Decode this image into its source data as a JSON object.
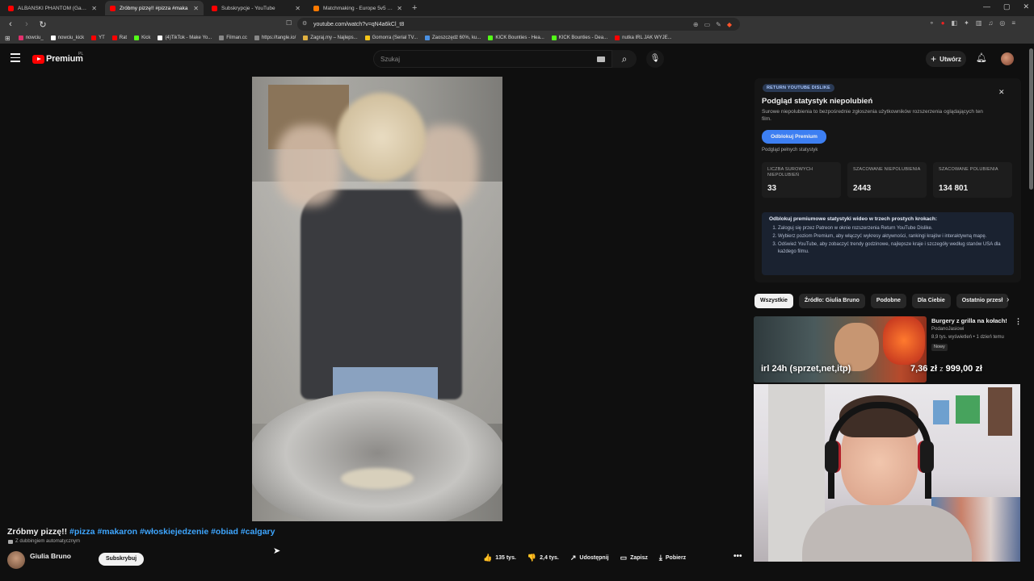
{
  "browser": {
    "tabs": [
      {
        "title": "ALBAŃSKI PHANTOM (Gang albani",
        "color": "#ff0000",
        "active": false
      },
      {
        "title": "Zróbmy pizzę!! #pizza #maka",
        "color": "#ff0000",
        "active": true
      },
      {
        "title": "Subskrypcje - YouTube",
        "color": "#ff0000",
        "active": false
      },
      {
        "title": "Matchmaking - Europe 5v5 Queue -",
        "color": "#ff7a00",
        "active": false
      }
    ],
    "url": "youtube.com/watch?v=qN4a6kCl_t8",
    "bookmarks": [
      {
        "label": "nowciu_",
        "color": "#e1306c"
      },
      {
        "label": "nowciu_kick",
        "color": "#ffffff"
      },
      {
        "label": "YT",
        "color": "#ff0000"
      },
      {
        "label": "Rat",
        "color": "#ff0000"
      },
      {
        "label": "Kick",
        "color": "#53fc18"
      },
      {
        "label": "(4)TikTok - Make Yo...",
        "color": "#ffffff"
      },
      {
        "label": "Filman.cc",
        "color": "#888888"
      },
      {
        "label": "https://tangle.io/",
        "color": "#888888"
      },
      {
        "label": "Zagraj.my – Najleps...",
        "color": "#e0b040"
      },
      {
        "label": "Gomorra (Serial TV...",
        "color": "#f5c518"
      },
      {
        "label": "Zaoszczędź 60%, ku...",
        "color": "#4a90e2"
      },
      {
        "label": "KICK Bounties - Hea...",
        "color": "#53fc18"
      },
      {
        "label": "KICK Bounties - Dea...",
        "color": "#53fc18"
      },
      {
        "label": "nutka IRL JAK WYJE...",
        "color": "#ff0000"
      }
    ]
  },
  "header": {
    "logo_text": "Premium",
    "logo_region": "PL",
    "search_placeholder": "Szukaj",
    "create_label": "Utwórz"
  },
  "video": {
    "title": "Zróbmy pizzę!!",
    "hashtags": "#pizza #makaron #włoskiejedzenie #obiad #calgary",
    "dub_note": "Z dubbingiem automatycznym",
    "channel": "Giulia Bruno",
    "subscribe_label": "Subskrybuj",
    "actions": [
      {
        "icon": "like-icon",
        "glyph": "👍",
        "label": "135 tys."
      },
      {
        "icon": "dislike-icon",
        "glyph": "👎",
        "label": "2,4 tys."
      },
      {
        "icon": "share-icon",
        "glyph": "↗",
        "label": "Udostępnij"
      },
      {
        "icon": "save-icon",
        "glyph": "▭",
        "label": "Zapisz"
      },
      {
        "icon": "download-icon",
        "glyph": "⤓",
        "label": "Pobierz"
      }
    ]
  },
  "ryd": {
    "badge": "RETURN YOUTUBE DISLIKE",
    "title": "Podgląd statystyk niepolubień",
    "description": "Surowe niepolubienia to bezpośrednie zgłoszenia użytkowników rozszerzenia oglądających ten film.",
    "unlock_label": "Odblokuj Premium",
    "sub_label": "Podgląd pełnych statystyk",
    "stats": [
      {
        "label": "LICZBA SUROWYCH NIEPOLUBIEŃ",
        "value": "33"
      },
      {
        "label": "SZACOWANE NIEPOLUBIENIA",
        "value": "2443"
      },
      {
        "label": "SZACOWANE POLUBIENIA",
        "value": "134 801"
      }
    ],
    "steps_heading": "Odblokuj premiumowe statystyki wideo w trzech prostych krokach:",
    "steps": [
      "Zaloguj się przez Patreon w oknie rozszerzenia Return YouTube Dislike.",
      "Wybierz poziom Premium, aby włączyć wykresy aktywności, rankingi krajów i interaktywną mapę.",
      "Odśwież YouTube, aby zobaczyć trendy godzinowe, najlepsze kraje i szczegóły według stanów USA dla każdego filmu."
    ]
  },
  "chips": [
    "Wszystkie",
    "Źródło: Giulia Bruno",
    "Podobne",
    "Dla Ciebie",
    "Ostatnio przesł"
  ],
  "recommended": {
    "title": "Burgery z grilla na kołach!",
    "channel": "PodanoJasiowi",
    "meta": "8,9 tys. wyświetleń • 1 dzień temu",
    "badge": "Nowy",
    "overlay_left": "irl 24h (sprzet,net,itp)",
    "overlay_price1": "7,36 zł",
    "overlay_sep": "z",
    "overlay_price2": "999,00 zł"
  }
}
